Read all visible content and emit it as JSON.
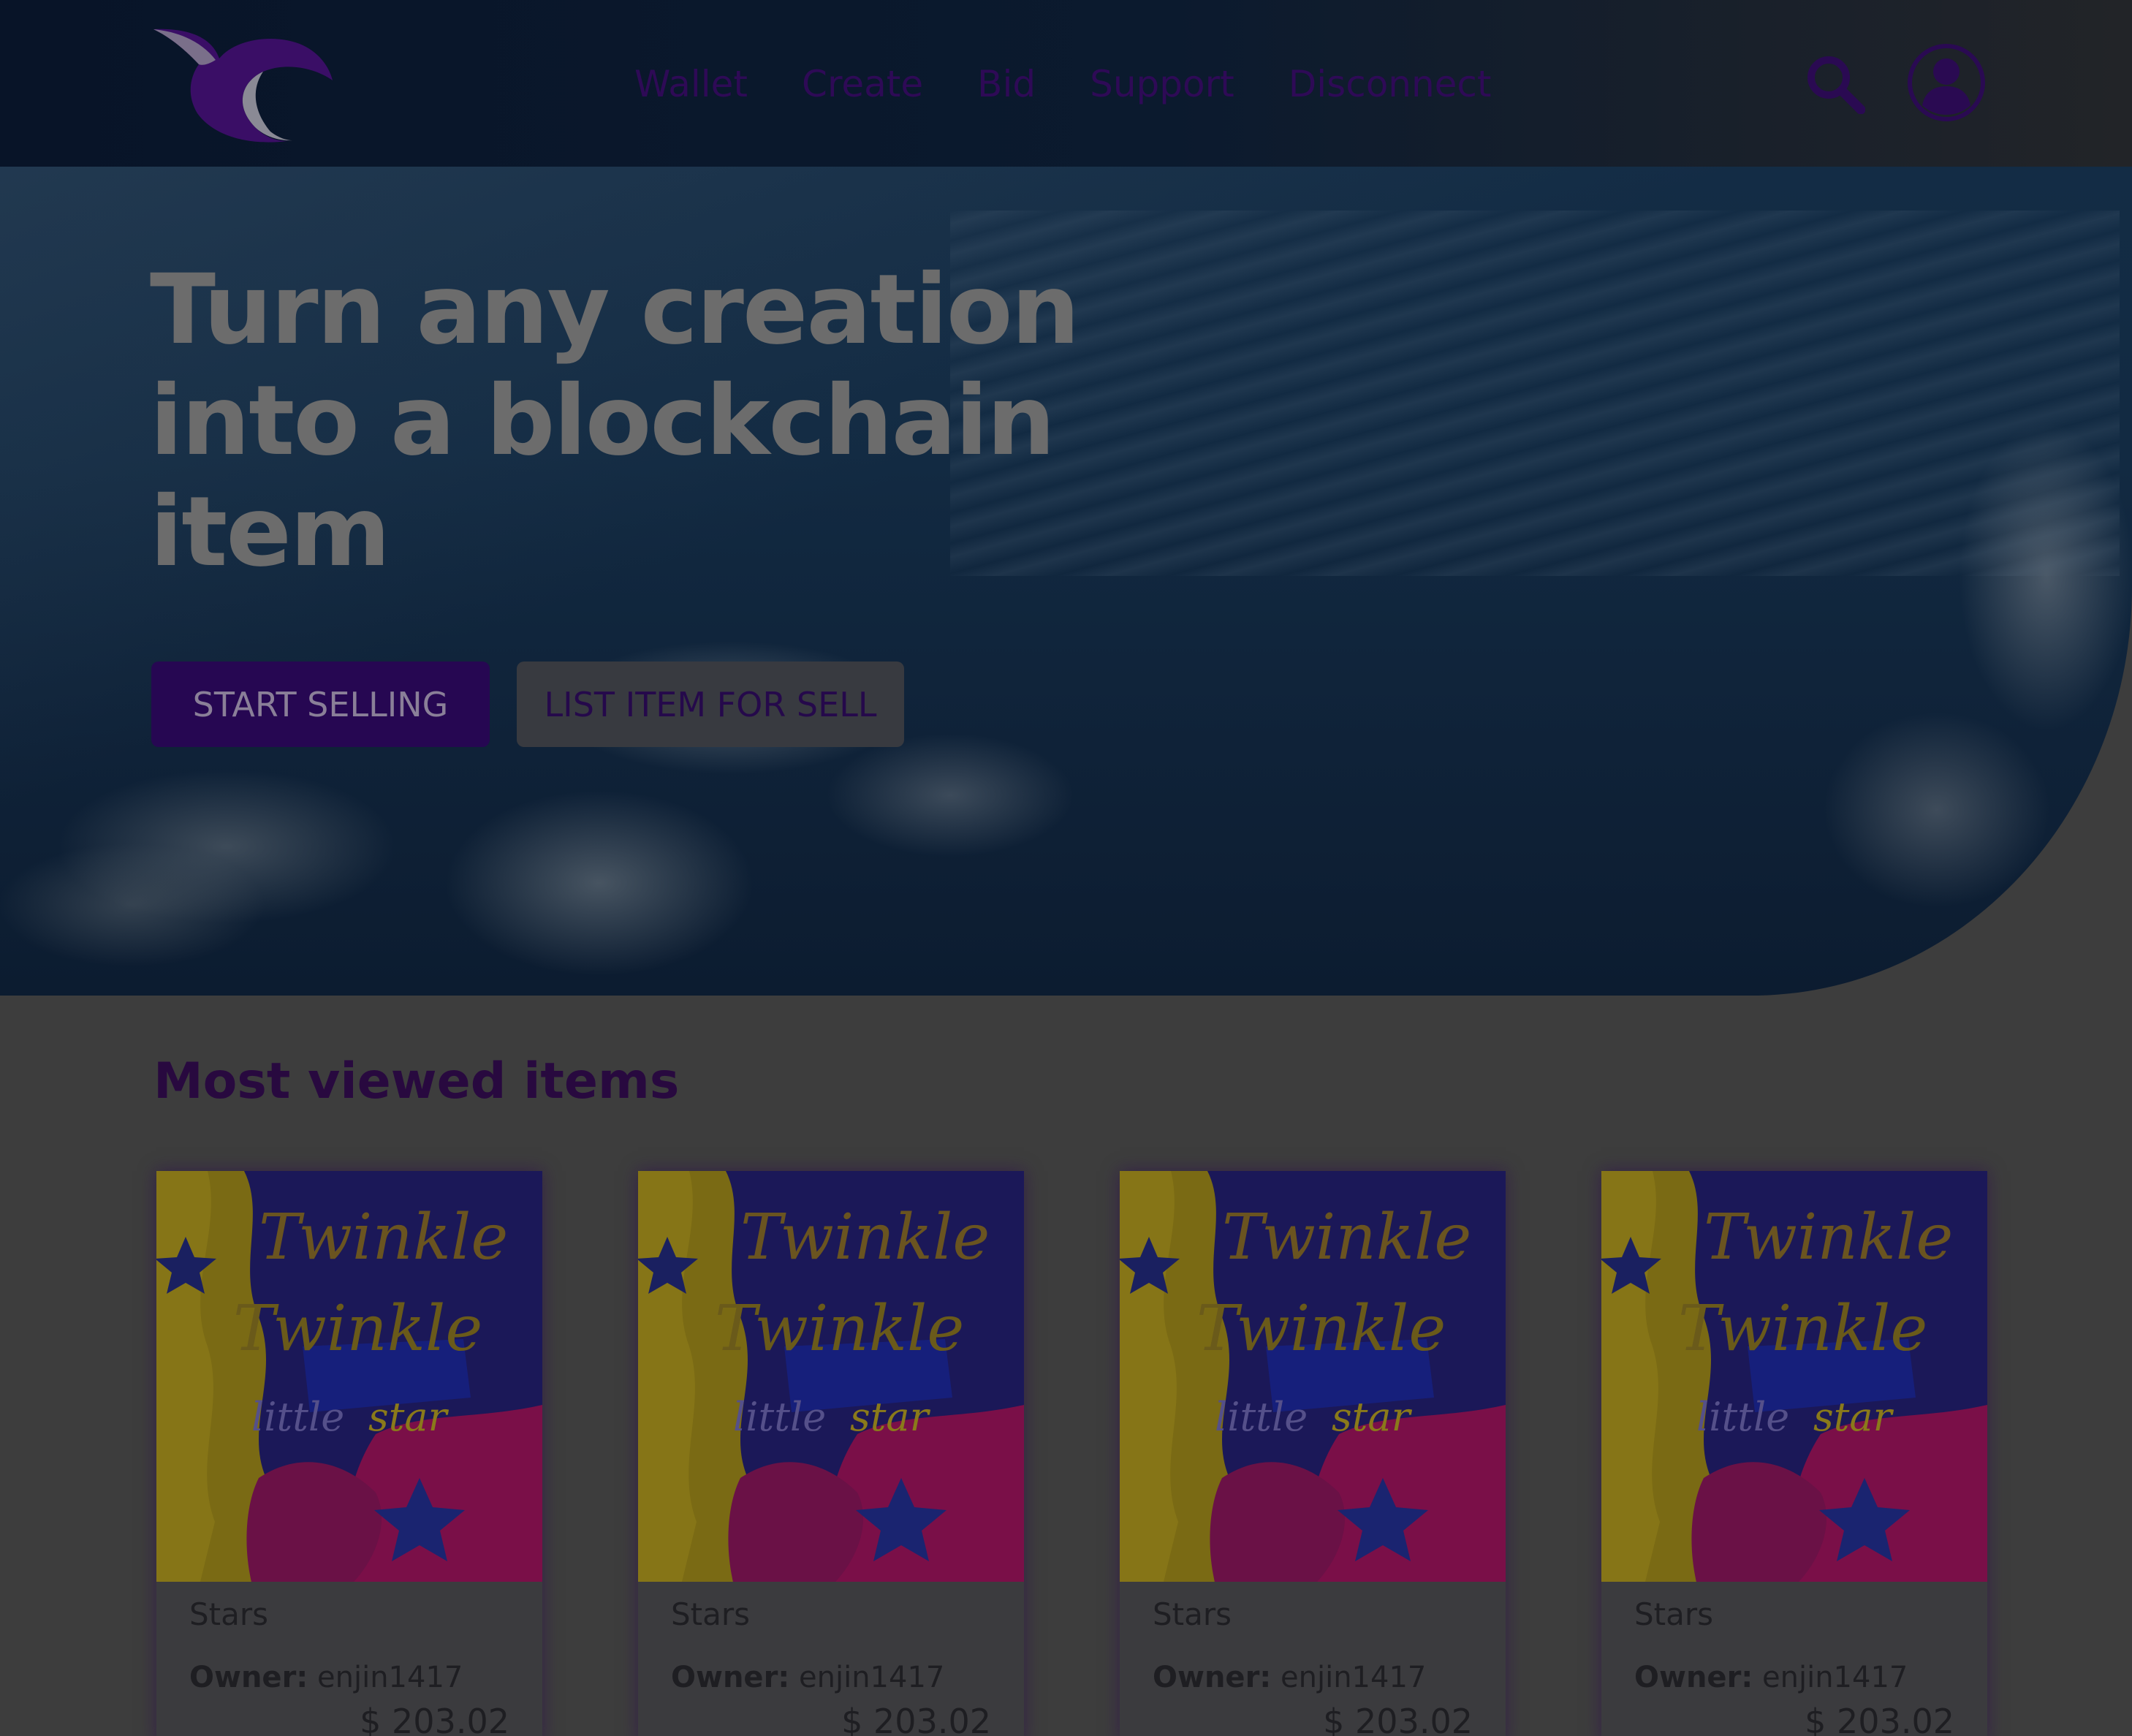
{
  "header": {
    "logo_name": "crescent-bird-logo",
    "nav": [
      {
        "label": "Wallet"
      },
      {
        "label": "Create"
      },
      {
        "label": "Bid"
      },
      {
        "label": "Support"
      },
      {
        "label": "Disconnect"
      }
    ],
    "icons": {
      "search": "search-icon",
      "profile": "user-profile-icon"
    }
  },
  "hero": {
    "title": "Turn any creation into a blockchain item",
    "primary_button": "START SELLING",
    "secondary_button": "LIST ITEM FOR SELL"
  },
  "most_viewed": {
    "title": "Most viewed items",
    "items": [
      {
        "artwork": "Twinkle Twinkle Little Star",
        "name": "Stars",
        "owner_label": "Owner:",
        "owner": "enjin1417",
        "price": "$ 203.02"
      },
      {
        "artwork": "Twinkle Twinkle Little Star",
        "name": "Stars",
        "owner_label": "Owner:",
        "owner": "enjin1417",
        "price": "$ 203.02"
      },
      {
        "artwork": "Twinkle Twinkle Little Star",
        "name": "Stars",
        "owner_label": "Owner:",
        "owner": "enjin1417",
        "price": "$ 203.02"
      },
      {
        "artwork": "Twinkle Twinkle Little Star",
        "name": "Stars",
        "owner_label": "Owner:",
        "owner": "enjin1417",
        "price": "$ 203.02"
      }
    ]
  },
  "colors": {
    "brand_purple": "#260752",
    "header_bg": "#081428",
    "page_bg": "#3d3d3d"
  }
}
